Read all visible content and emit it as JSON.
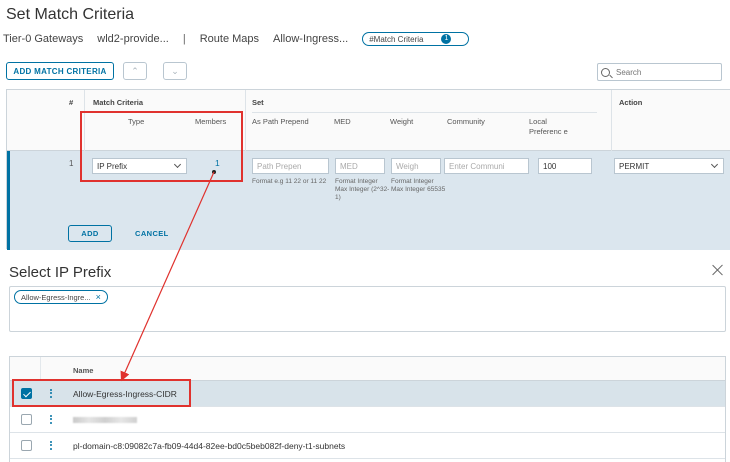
{
  "page": {
    "title": "Set Match Criteria",
    "breadcrumb": {
      "item1": "Tier-0 Gateways",
      "item2": "wld2-provide...",
      "separator": "|",
      "item3": "Route Maps",
      "item4": "Allow-Ingress...",
      "chip_label": "#Match Criteria",
      "chip_badge": "1"
    }
  },
  "toolbar": {
    "add_label": "ADD MATCH CRITERIA",
    "up_glyph": "⌃",
    "down_glyph": "⌄",
    "search_placeholder": "Search"
  },
  "grid": {
    "headers": {
      "num": "#",
      "match_criteria": "Match Criteria",
      "type": "Type",
      "members": "Members",
      "set": "Set",
      "as_path": "As Path Prepend",
      "med": "MED",
      "weight": "Weight",
      "community": "Community",
      "local_pref": "Local Preferenc e",
      "action": "Action"
    },
    "row": {
      "num": "1",
      "type_value": "IP Prefix",
      "members": "1",
      "as_path_placeholder": "Path Prepen",
      "med_placeholder": "MED",
      "weight_placeholder": "Weigh",
      "community_placeholder": "Enter Communi",
      "local_pref_value": "100",
      "action_value": "PERMIT",
      "as_path_hint": "Format e.g 11 22 or 11 22",
      "med_hint": "Format Integer Max Integer (2^32-1)",
      "weight_hint": "Format Integer Max Integer 65535",
      "add_label": "ADD",
      "cancel_label": "CANCEL"
    }
  },
  "modal": {
    "title": "Select IP Prefix",
    "selected_chip": "Allow-Egress-Ingre...",
    "chip_close": "×",
    "table": {
      "header_name": "Name",
      "rows": [
        {
          "name": "Allow-Egress-Ingress-CIDR",
          "checked": true
        },
        {
          "name": "",
          "checked": false
        },
        {
          "name": "pl-domain-c8:09082c7a-fb09-44d4-82ee-bd0c5beb082f-deny-t1-subnets",
          "checked": false
        }
      ]
    }
  },
  "colors": {
    "accent": "#0072a3",
    "highlight": "#e0322e",
    "row_selected": "#dbe6ee"
  }
}
